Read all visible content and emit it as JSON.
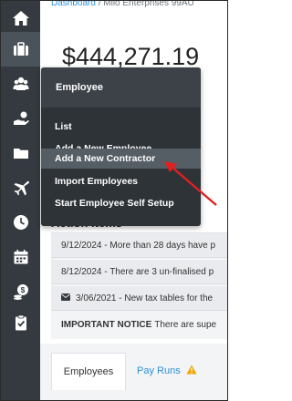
{
  "breadcrumb": {
    "home": "Dashboard",
    "separator": "/",
    "business": "Milo Enterprises 99AU"
  },
  "amount": "$444,271.19",
  "sidebar": {
    "items": [
      {
        "name": "home",
        "icon": "home-icon"
      },
      {
        "name": "briefcase",
        "icon": "briefcase-icon",
        "active": true
      },
      {
        "name": "employees",
        "icon": "employees-icon"
      },
      {
        "name": "payments",
        "icon": "hand-money-icon"
      },
      {
        "name": "folder",
        "icon": "folder-icon"
      },
      {
        "name": "travel",
        "icon": "plane-icon"
      },
      {
        "name": "time",
        "icon": "clock-icon"
      },
      {
        "name": "calendar",
        "icon": "calendar-icon"
      },
      {
        "name": "coins",
        "icon": "coins-icon"
      },
      {
        "name": "reports",
        "icon": "clipboard-icon"
      }
    ]
  },
  "dropdown": {
    "header": "Employee",
    "items": [
      "List",
      "Add a New Employee",
      "Add a New Contractor",
      "Import Employees",
      "Start Employee Self Setup"
    ],
    "highlighted_index": 2
  },
  "action_items": {
    "title": "Action Items",
    "rows": [
      "9/12/2024 - More than 28 days have p",
      "8/12/2024 - There are 3 un-finalised p",
      "3/06/2021 - New tax tables for the"
    ],
    "notice_label": "IMPORTANT NOTICE",
    "notice_text": "There are supe"
  },
  "tabs": {
    "employees": "Employees",
    "pay_runs": "Pay Runs"
  },
  "colors": {
    "sidebar": "#343a40",
    "dropdown": "#2e3338",
    "highlight": "#555d65",
    "link": "#2b8fd6",
    "arrow": "#e02020",
    "warning": "#f0a500"
  }
}
